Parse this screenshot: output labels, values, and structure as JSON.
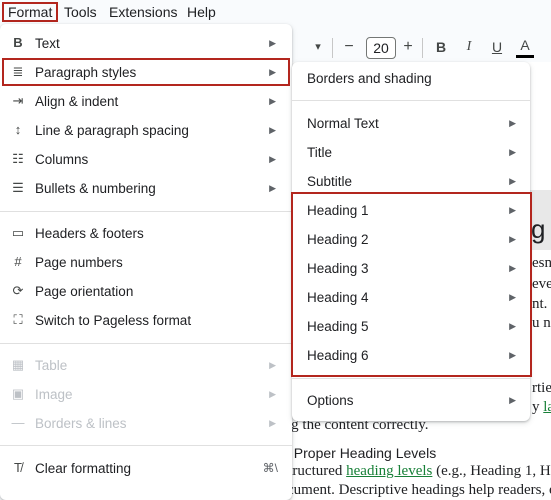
{
  "menubar": {
    "items": [
      "Format",
      "Tools",
      "Extensions",
      "Help"
    ]
  },
  "toolbar": {
    "dropdown_glyph": "▾",
    "decrease": "−",
    "font_size": "20",
    "increase": "+",
    "bold": "B",
    "italic": "I",
    "underline": "U",
    "text_color": "A"
  },
  "format_menu": {
    "items": [
      {
        "icon": "bold-icon",
        "glyph": "B",
        "label": "Text",
        "submenu": true,
        "disabled": false
      },
      {
        "icon": "paragraph-styles-icon",
        "glyph": "≣",
        "label": "Paragraph styles",
        "submenu": true,
        "disabled": false
      },
      {
        "icon": "align-indent-icon",
        "glyph": "⇥",
        "label": "Align & indent",
        "submenu": true,
        "disabled": false
      },
      {
        "icon": "line-spacing-icon",
        "glyph": "↕",
        "label": "Line & paragraph spacing",
        "submenu": true,
        "disabled": false
      },
      {
        "icon": "columns-icon",
        "glyph": "☷",
        "label": "Columns",
        "submenu": true,
        "disabled": false
      },
      {
        "icon": "bullets-icon",
        "glyph": "☰",
        "label": "Bullets & numbering",
        "submenu": true,
        "disabled": false
      },
      {
        "icon": "headers-footers-icon",
        "glyph": "▭",
        "label": "Headers & footers",
        "submenu": false,
        "disabled": false
      },
      {
        "icon": "page-numbers-icon",
        "glyph": "#",
        "label": "Page numbers",
        "submenu": false,
        "disabled": false
      },
      {
        "icon": "page-orientation-icon",
        "glyph": "⟳",
        "label": "Page orientation",
        "submenu": false,
        "disabled": false
      },
      {
        "icon": "pageless-icon",
        "glyph": "⛶",
        "label": "Switch to Pageless format",
        "submenu": false,
        "disabled": false
      },
      {
        "icon": "table-icon",
        "glyph": "▦",
        "label": "Table",
        "submenu": true,
        "disabled": true
      },
      {
        "icon": "image-icon",
        "glyph": "▣",
        "label": "Image",
        "submenu": true,
        "disabled": true
      },
      {
        "icon": "borders-lines-icon",
        "glyph": "—",
        "label": "Borders & lines",
        "submenu": true,
        "disabled": true
      },
      {
        "icon": "clear-formatting-icon",
        "glyph": "T̸",
        "label": "Clear formatting",
        "submenu": false,
        "disabled": false,
        "shortcut": "⌘\\"
      }
    ]
  },
  "paragraph_menu": {
    "items": [
      {
        "label": "Borders and shading",
        "submenu": false
      },
      {
        "label": "Normal Text",
        "submenu": true
      },
      {
        "label": "Title",
        "submenu": true
      },
      {
        "label": "Subtitle",
        "submenu": true
      },
      {
        "label": "Heading 1",
        "submenu": true
      },
      {
        "label": "Heading 2",
        "submenu": true
      },
      {
        "label": "Heading 3",
        "submenu": true
      },
      {
        "label": "Heading 4",
        "submenu": true
      },
      {
        "label": "Heading 5",
        "submenu": true
      },
      {
        "label": "Heading 6",
        "submenu": true
      },
      {
        "label": "Options",
        "submenu": true
      }
    ]
  },
  "document": {
    "heading_fragment": "g",
    "right_fragments": [
      "esn",
      "ever",
      "nt. ,",
      "u n"
    ],
    "line_a_fragment": "rtie",
    "line_b_prefix": "y ",
    "line_b_link": "la",
    "line_c": "ding the content correctly.",
    "subheading": "ply Proper Heading Levels",
    "line_d_prefix": "e structured ",
    "line_d_link": "heading levels",
    "line_d_suffix": " (e.g., Heading 1, H",
    "line_e": "document. Descriptive headings help readers, es"
  },
  "colors": {
    "highlight_border": "#b3261e",
    "link": "#188038",
    "menu_bg": "#ffffff"
  }
}
